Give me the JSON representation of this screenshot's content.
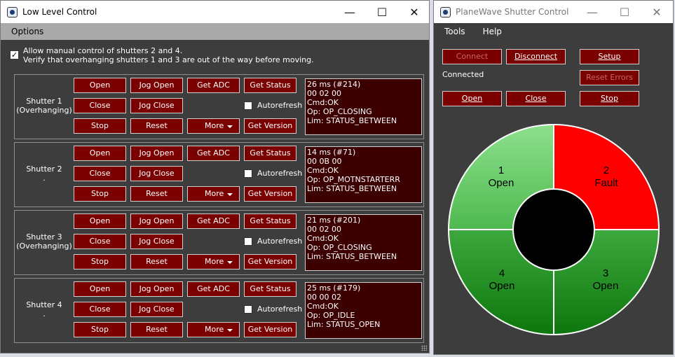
{
  "low_level": {
    "title": "Low Level Control",
    "menu": [
      "Options"
    ],
    "allow_manual_checked": true,
    "note_line1": "Allow manual control of shutters 2 and 4.",
    "note_line2": "Verify that overhanging shutters 1 and 3 are out of the way before moving.",
    "buttons": {
      "open": "Open",
      "jog_open": "Jog Open",
      "get_adc": "Get ADC",
      "get_status": "Get Status",
      "close": "Close",
      "jog_close": "Jog Close",
      "autorefresh": "Autorefresh",
      "stop": "Stop",
      "reset": "Reset",
      "more": "More",
      "get_version": "Get Version"
    },
    "shutters": [
      {
        "label1": "Shutter 1",
        "label2": "(Overhanging)",
        "status": [
          "26 ms (#214)",
          "00 02 00",
          "Cmd:OK",
          "Op: OP_CLOSING",
          "Lim: STATUS_BETWEEN"
        ]
      },
      {
        "label1": "Shutter 2",
        "label2": ".",
        "status": [
          "14 ms (#71)",
          "00 0B 00",
          "Cmd:OK",
          "Op: OP_MOTNSTARTERR",
          "Lim: STATUS_BETWEEN"
        ]
      },
      {
        "label1": "Shutter 3",
        "label2": "(Overhanging)",
        "status": [
          "21 ms (#201)",
          "00 02 00",
          "Cmd:OK",
          "Op: OP_CLOSING",
          "Lim: STATUS_BETWEEN"
        ]
      },
      {
        "label1": "Shutter 4",
        "label2": ".",
        "status": [
          "25 ms (#179)",
          "00 00 02",
          "Cmd:OK",
          "Op: OP_IDLE",
          "Lim: STATUS_OPEN"
        ]
      }
    ]
  },
  "planewave": {
    "title": "PlaneWave Shutter Control",
    "menu": [
      "Tools",
      "Help"
    ],
    "connect": "Connect",
    "disconnect": "Disconnect",
    "setup": "Setup",
    "reset_errors": "Reset Errors",
    "connection_status": "Connected",
    "open": "Open",
    "close": "Close",
    "stop": "Stop",
    "quadrants": [
      {
        "num": "1",
        "state": "Open",
        "color": "#86df86"
      },
      {
        "num": "2",
        "state": "Fault",
        "color": "#ff0000"
      },
      {
        "num": "3",
        "state": "Open",
        "color": "#138a13"
      },
      {
        "num": "4",
        "state": "Open",
        "color": "#138a13"
      }
    ]
  },
  "window_controls": {
    "minimize": "—",
    "maximize": "☐",
    "close": "✕"
  }
}
